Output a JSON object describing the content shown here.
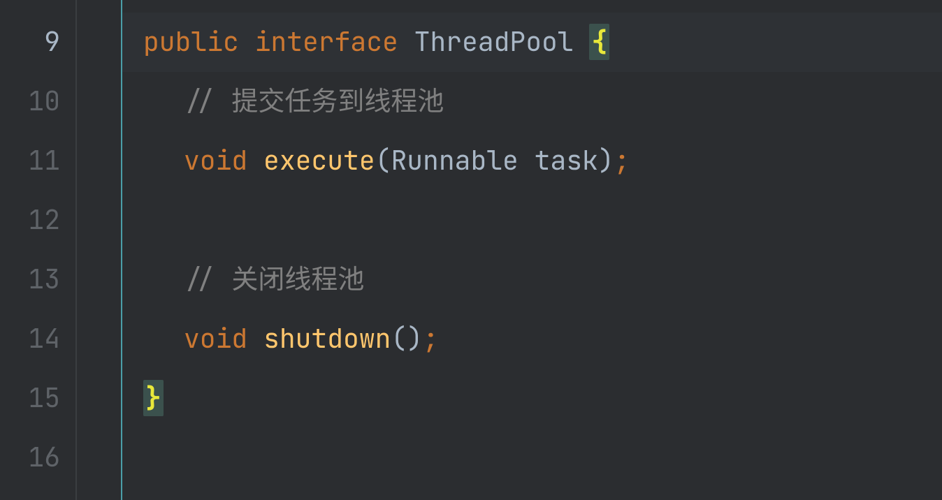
{
  "editor": {
    "startLine": 9,
    "lines": [
      {
        "num": 9,
        "active": true,
        "highlighted": true,
        "tokens": [
          {
            "text": "public ",
            "cls": "kw"
          },
          {
            "text": "interface ",
            "cls": "kw"
          },
          {
            "text": "ThreadPool ",
            "cls": "type"
          },
          {
            "text": "{",
            "cls": "brace",
            "match": true
          }
        ]
      },
      {
        "num": 10,
        "tokens": [
          {
            "text": "",
            "cls": "indent"
          },
          {
            "text": "// 提交任务到线程池",
            "cls": "comment"
          }
        ]
      },
      {
        "num": 11,
        "tokens": [
          {
            "text": "",
            "cls": "indent"
          },
          {
            "text": "void ",
            "cls": "kw"
          },
          {
            "text": "execute",
            "cls": "method"
          },
          {
            "text": "(",
            "cls": "paren"
          },
          {
            "text": "Runnable task",
            "cls": "plain"
          },
          {
            "text": ")",
            "cls": "paren"
          },
          {
            "text": ";",
            "cls": "semi"
          }
        ]
      },
      {
        "num": 12,
        "tokens": []
      },
      {
        "num": 13,
        "tokens": [
          {
            "text": "",
            "cls": "indent"
          },
          {
            "text": "// 关闭线程池",
            "cls": "comment"
          }
        ]
      },
      {
        "num": 14,
        "tokens": [
          {
            "text": "",
            "cls": "indent"
          },
          {
            "text": "void ",
            "cls": "kw"
          },
          {
            "text": "shutdown",
            "cls": "method"
          },
          {
            "text": "()",
            "cls": "paren"
          },
          {
            "text": ";",
            "cls": "semi"
          }
        ]
      },
      {
        "num": 15,
        "tokens": [
          {
            "text": "}",
            "cls": "brace",
            "match": true
          }
        ]
      },
      {
        "num": 16,
        "tokens": []
      }
    ]
  }
}
